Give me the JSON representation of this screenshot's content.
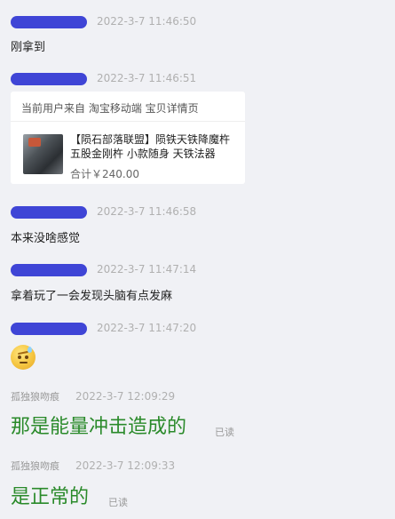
{
  "messages": [
    {
      "time": "2022-3-7 11:46:50",
      "text": "刚拿到"
    },
    {
      "time": "2022-3-7 11:46:51"
    },
    {
      "time": "2022-3-7 11:46:58",
      "text": "本来没啥感觉"
    },
    {
      "time": "2022-3-7 11:47:14",
      "text": "拿着玩了一会发现头脑有点发麻"
    },
    {
      "time": "2022-3-7 11:47:20",
      "emoji": "sweat-face-icon"
    },
    {
      "name": "孤独狼吻痕",
      "time": "2022-3-7 12:09:29",
      "text": "那是能量冲击造成的",
      "read": "已读"
    },
    {
      "name": "孤独狼吻痕",
      "time": "2022-3-7 12:09:33",
      "text": "是正常的",
      "read": "已读"
    }
  ],
  "card": {
    "header": "当前用户来自 淘宝移动端 宝贝详情页",
    "title": "【陨石部落联盟】陨铁天铁降魔杵五股金刚杵 小款随身 天铁法器",
    "price": "合计￥240.00"
  },
  "colors": {
    "redaction": "#3f45d6",
    "reply_text": "#2a8a2a",
    "background": "#f0f1f5"
  }
}
